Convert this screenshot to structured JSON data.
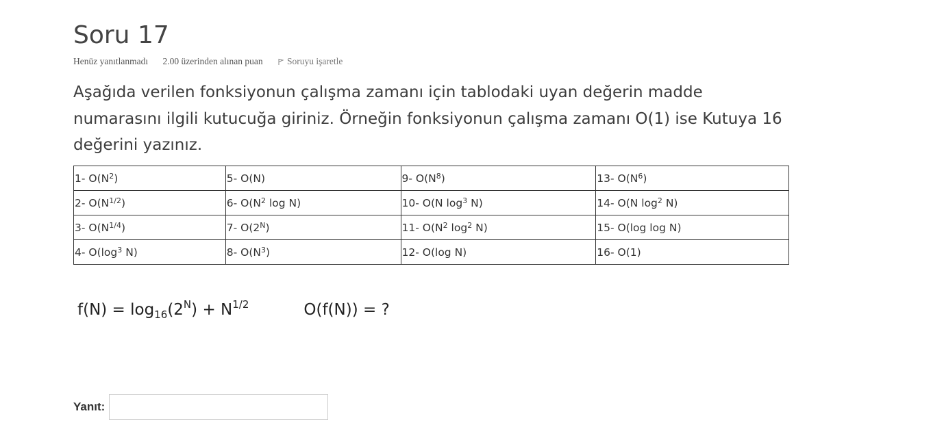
{
  "question": {
    "title": "Soru 17",
    "status": "Henüz yanıtlanmadı",
    "mark": "2.00 üzerinden alınan puan",
    "flag_label": "Soruyu işaretle",
    "text": "Aşağıda verilen fonksiyonun çalışma zamanı için tablodaki uyan değerin madde numarasını ilgili kutucuğa giriniz. Örneğin fonksiyonun çalışma zamanı O(1) ise Kutuya 16 değerini yazınız."
  },
  "table": {
    "cells": [
      [
        {
          "pre": "1- O(N",
          "sup": "2",
          "post": ")"
        },
        {
          "pre": "5- O(N)",
          "sup": "",
          "post": ""
        },
        {
          "pre": "9- O(N",
          "sup": "8",
          "post": ")"
        },
        {
          "pre": "13- O(N",
          "sup": "6",
          "post": ")"
        }
      ],
      [
        {
          "pre": "2- O(N",
          "sup": "1/2",
          "post": ")"
        },
        {
          "pre": "6- O(N",
          "sup": "2",
          "post": " log N)"
        },
        {
          "pre": "10- O(N log",
          "sup": "3",
          "post": " N)"
        },
        {
          "pre": "14- O(N log",
          "sup": "2",
          "post": " N)"
        }
      ],
      [
        {
          "pre": "3- O(N",
          "sup": "1/4",
          "post": ")"
        },
        {
          "pre": "7- O(2",
          "sup": "N",
          "post": ")"
        },
        {
          "pre": "11- O(N",
          "sup": "2",
          "post": " log",
          "sup2": "2",
          "post2": " N)"
        },
        {
          "pre": "15- O(log log N)",
          "sup": "",
          "post": ""
        }
      ],
      [
        {
          "pre": "4- O(log",
          "sup": "3",
          "post": " N)"
        },
        {
          "pre": "8- O(N",
          "sup": "3",
          "post": ")"
        },
        {
          "pre": "12- O(log N)",
          "sup": "",
          "post": ""
        },
        {
          "pre": "16- O(1)",
          "sup": "",
          "post": ""
        }
      ]
    ]
  },
  "formula": {
    "f_pre": "f(N) = log",
    "f_sub": "16",
    "f_mid": "(2",
    "f_sup1": "N",
    "f_mid2": ") + N",
    "f_sup2": "1/2",
    "big_o": "O(f(N)) = ?"
  },
  "answer": {
    "label": "Yanıt:",
    "value": ""
  },
  "colors": {
    "text": "#333333",
    "border": "#333333",
    "input_border": "#cccccc"
  }
}
